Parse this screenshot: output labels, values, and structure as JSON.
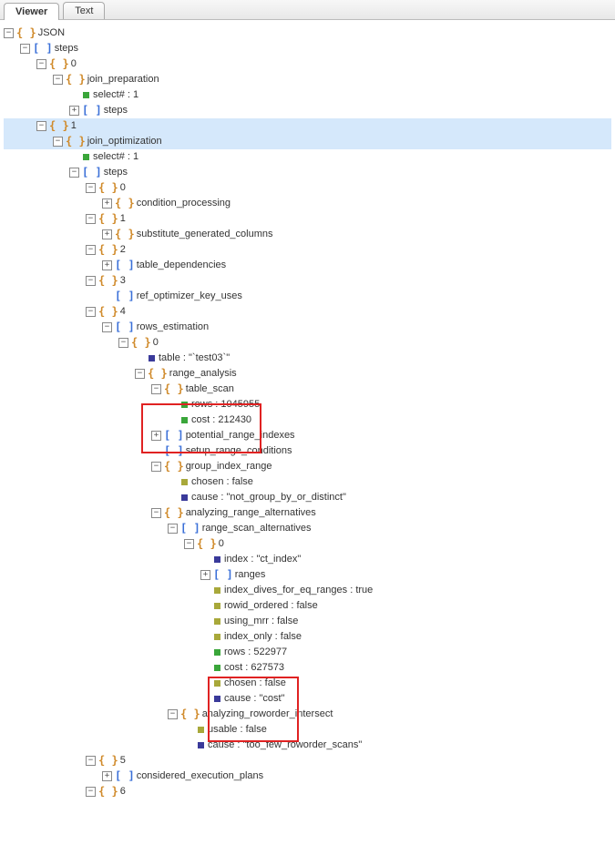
{
  "tabs": {
    "viewer": "Viewer",
    "text": "Text"
  },
  "root": "JSON",
  "k": {
    "steps": "steps",
    "n0": "0",
    "n1": "1",
    "n2": "2",
    "n3": "3",
    "n4": "4",
    "n5": "5",
    "n6": "6",
    "join_preparation": "join_preparation",
    "select_hash": "select# : 1",
    "join_optimization": "join_optimization",
    "condition_processing": "condition_processing",
    "substitute_generated_columns": "substitute_generated_columns",
    "table_dependencies": "table_dependencies",
    "ref_optimizer_key_uses": "ref_optimizer_key_uses",
    "rows_estimation": "rows_estimation",
    "table_test03": "table : \"`test03`\"",
    "range_analysis": "range_analysis",
    "table_scan": "table_scan",
    "rows_1045955": "rows : 1045955",
    "cost_212430": "cost : 212430",
    "potential_range_indexes": "potential_range_indexes",
    "setup_range_conditions": "setup_range_conditions",
    "group_index_range": "group_index_range",
    "chosen_false": "chosen : false",
    "cause_not_group": "cause : \"not_group_by_or_distinct\"",
    "analyzing_range_alternatives": "analyzing_range_alternatives",
    "range_scan_alternatives": "range_scan_alternatives",
    "index_ct": "index : \"ct_index\"",
    "ranges": "ranges",
    "index_dives": "index_dives_for_eq_ranges : true",
    "rowid_ordered": "rowid_ordered : false",
    "using_mrr": "using_mrr : false",
    "index_only": "index_only : false",
    "rows_522977": "rows : 522977",
    "cost_627573": "cost : 627573",
    "cause_cost": "cause : \"cost\"",
    "analyzing_roworder_intersect": "analyzing_roworder_intersect",
    "usable_false": "usable : false",
    "cause_too_few": "cause : \"too_few_roworder_scans\"",
    "considered_execution_plans": "considered_execution_plans"
  }
}
